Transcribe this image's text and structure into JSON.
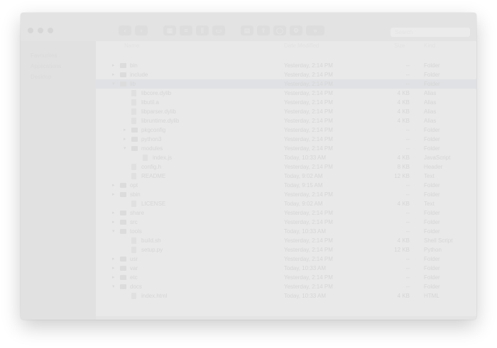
{
  "window": {
    "title": ""
  },
  "toolbar": {
    "buttons": [
      {
        "name": "back-button",
        "glyph": "‹"
      },
      {
        "name": "forward-button",
        "glyph": "›"
      },
      {
        "name": "view-icons-button",
        "glyph": "▦"
      },
      {
        "name": "view-list-button",
        "glyph": "≡"
      },
      {
        "name": "view-columns-button",
        "glyph": "⫼"
      },
      {
        "name": "view-gallery-button",
        "glyph": "▭"
      },
      {
        "name": "group-button",
        "glyph": "▤"
      },
      {
        "name": "share-button",
        "glyph": "⇪"
      },
      {
        "name": "tags-button",
        "glyph": "◯"
      },
      {
        "name": "action-button",
        "glyph": "⚙"
      },
      {
        "name": "more-button",
        "glyph": "»"
      }
    ]
  },
  "search": {
    "placeholder": "Search"
  },
  "sidebar": {
    "items": [
      "Favourites",
      "Applications",
      "Desktop"
    ]
  },
  "columns": {
    "name": "Name",
    "date": "Date Modified",
    "size": "Size",
    "kind": "Kind"
  },
  "rows": [
    {
      "depth": 0,
      "disclosure": "▸",
      "icon": "folder",
      "name": "bin",
      "date": "Yesterday, 2:14 PM",
      "size": "--",
      "kind": "Folder",
      "selected": false
    },
    {
      "depth": 0,
      "disclosure": "▸",
      "icon": "folder",
      "name": "include",
      "date": "Yesterday, 2:14 PM",
      "size": "--",
      "kind": "Folder",
      "selected": false
    },
    {
      "depth": 0,
      "disclosure": "▾",
      "icon": "folder",
      "name": "lib",
      "date": "Yesterday, 2:14 PM",
      "size": "--",
      "kind": "Folder",
      "selected": true
    },
    {
      "depth": 1,
      "disclosure": "",
      "icon": "doc",
      "name": "libcore.dylib",
      "date": "Yesterday, 2:14 PM",
      "size": "4 KB",
      "kind": "Alias",
      "selected": false
    },
    {
      "depth": 1,
      "disclosure": "",
      "icon": "doc",
      "name": "libutil.a",
      "date": "Yesterday, 2:14 PM",
      "size": "4 KB",
      "kind": "Alias",
      "selected": false
    },
    {
      "depth": 1,
      "disclosure": "",
      "icon": "doc",
      "name": "libparser.dylib",
      "date": "Yesterday, 2:14 PM",
      "size": "4 KB",
      "kind": "Alias",
      "selected": false
    },
    {
      "depth": 1,
      "disclosure": "",
      "icon": "doc",
      "name": "libruntime.dylib",
      "date": "Yesterday, 2:14 PM",
      "size": "4 KB",
      "kind": "Alias",
      "selected": false
    },
    {
      "depth": 1,
      "disclosure": "▸",
      "icon": "folder",
      "name": "pkgconfig",
      "date": "Yesterday, 2:14 PM",
      "size": "--",
      "kind": "Folder",
      "selected": false
    },
    {
      "depth": 1,
      "disclosure": "▸",
      "icon": "folder",
      "name": "python3",
      "date": "Yesterday, 2:14 PM",
      "size": "--",
      "kind": "Folder",
      "selected": false
    },
    {
      "depth": 1,
      "disclosure": "▾",
      "icon": "folder",
      "name": "modules",
      "date": "Yesterday, 2:14 PM",
      "size": "--",
      "kind": "Folder",
      "selected": false
    },
    {
      "depth": 2,
      "disclosure": "",
      "icon": "doc",
      "name": "index.js",
      "date": "Today, 10:33 AM",
      "size": "4 KB",
      "kind": "JavaScript",
      "selected": false
    },
    {
      "depth": 1,
      "disclosure": "",
      "icon": "doc",
      "name": "config.h",
      "date": "Yesterday, 2:14 PM",
      "size": "8 KB",
      "kind": "Header",
      "selected": false
    },
    {
      "depth": 1,
      "disclosure": "",
      "icon": "doc",
      "name": "README",
      "date": "Today, 9:02 AM",
      "size": "12 KB",
      "kind": "Text",
      "selected": false
    },
    {
      "depth": 0,
      "disclosure": "▸",
      "icon": "folder",
      "name": "opt",
      "date": "Today, 9:15 AM",
      "size": "--",
      "kind": "Folder",
      "selected": false
    },
    {
      "depth": 0,
      "disclosure": "▸",
      "icon": "folder",
      "name": "sbin",
      "date": "Yesterday, 2:14 PM",
      "size": "--",
      "kind": "Folder",
      "selected": false
    },
    {
      "depth": 1,
      "disclosure": "",
      "icon": "doc",
      "name": "LICENSE",
      "date": "Today, 9:02 AM",
      "size": "4 KB",
      "kind": "Text",
      "selected": false
    },
    {
      "depth": 0,
      "disclosure": "▸",
      "icon": "folder",
      "name": "share",
      "date": "Yesterday, 2:14 PM",
      "size": "--",
      "kind": "Folder",
      "selected": false
    },
    {
      "depth": 0,
      "disclosure": "▸",
      "icon": "folder",
      "name": "src",
      "date": "Yesterday, 2:14 PM",
      "size": "--",
      "kind": "Folder",
      "selected": false
    },
    {
      "depth": 0,
      "disclosure": "▾",
      "icon": "folder",
      "name": "tools",
      "date": "Today, 10:33 AM",
      "size": "--",
      "kind": "Folder",
      "selected": false
    },
    {
      "depth": 1,
      "disclosure": "",
      "icon": "doc",
      "name": "build.sh",
      "date": "Yesterday, 2:14 PM",
      "size": "4 KB",
      "kind": "Shell Script",
      "selected": false
    },
    {
      "depth": 1,
      "disclosure": "",
      "icon": "doc",
      "name": "setup.py",
      "date": "Yesterday, 2:14 PM",
      "size": "12 KB",
      "kind": "Python",
      "selected": false
    },
    {
      "depth": 0,
      "disclosure": "▸",
      "icon": "folder",
      "name": "usr",
      "date": "Yesterday, 2:14 PM",
      "size": "--",
      "kind": "Folder",
      "selected": false
    },
    {
      "depth": 0,
      "disclosure": "▸",
      "icon": "folder",
      "name": "var",
      "date": "Today, 10:33 AM",
      "size": "--",
      "kind": "Folder",
      "selected": false
    },
    {
      "depth": 0,
      "disclosure": "▸",
      "icon": "folder",
      "name": "etc",
      "date": "Yesterday, 2:14 PM",
      "size": "--",
      "kind": "Folder",
      "selected": false
    },
    {
      "depth": 0,
      "disclosure": "▾",
      "icon": "folder",
      "name": "docs",
      "date": "Yesterday, 2:14 PM",
      "size": "--",
      "kind": "Folder",
      "selected": false
    },
    {
      "depth": 1,
      "disclosure": "",
      "icon": "doc",
      "name": "index.html",
      "date": "Today, 10:33 AM",
      "size": "4 KB",
      "kind": "HTML",
      "selected": false
    }
  ]
}
